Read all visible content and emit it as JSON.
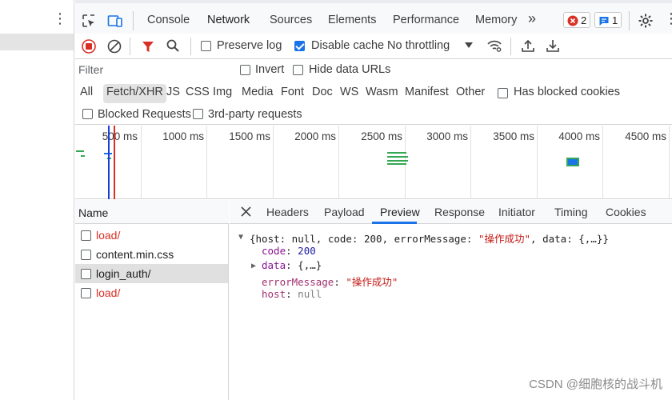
{
  "tabs": [
    "Console",
    "Network",
    "Sources",
    "Elements",
    "Performance",
    "Memory"
  ],
  "more_tabs_label": "»",
  "badges": {
    "errors": "2",
    "messages": "1"
  },
  "toolbar": {
    "preserve_log": "Preserve log",
    "disable_cache": "Disable cache",
    "throttling": "No throttling"
  },
  "filter": {
    "placeholder": "Filter",
    "invert": "Invert",
    "hide_data_urls": "Hide data URLs"
  },
  "types": [
    "All",
    "Fetch/XHR",
    "JS",
    "CSS",
    "Img",
    "Media",
    "Font",
    "Doc",
    "WS",
    "Wasm",
    "Manifest",
    "Other"
  ],
  "has_blocked_cookies": "Has blocked cookies",
  "blocked_requests": "Blocked Requests",
  "third_party": "3rd-party requests",
  "timeline_labels": [
    "500 ms",
    "1000 ms",
    "1500 ms",
    "2000 ms",
    "2500 ms",
    "3000 ms",
    "3500 ms",
    "4000 ms",
    "4500 ms"
  ],
  "name_header": "Name",
  "requests": [
    {
      "name": "load/",
      "error": true
    },
    {
      "name": "content.min.css",
      "error": false
    },
    {
      "name": "login_auth/",
      "error": false
    },
    {
      "name": "load/",
      "error": true
    }
  ],
  "detail_tabs": [
    "Headers",
    "Payload",
    "Preview",
    "Response",
    "Initiator",
    "Timing",
    "Cookies"
  ],
  "preview": {
    "summary_open": "{host: null, code: 200, errorMessage: ",
    "summary_msg": "\"操作成功\"",
    "summary_close": ", data: {,…}}",
    "code_key": "code",
    "code_val": "200",
    "data_key": "data",
    "data_val": "{,…}",
    "error_key": "errorMessage",
    "error_val": "\"操作成功\"",
    "host_key": "host",
    "host_val": "null"
  },
  "watermark": "CSDN @细胞核的战斗机",
  "colors": {
    "accent": "#1a73e8",
    "error": "#d93025",
    "record": "#d93025",
    "bar_green": "#34a853"
  }
}
